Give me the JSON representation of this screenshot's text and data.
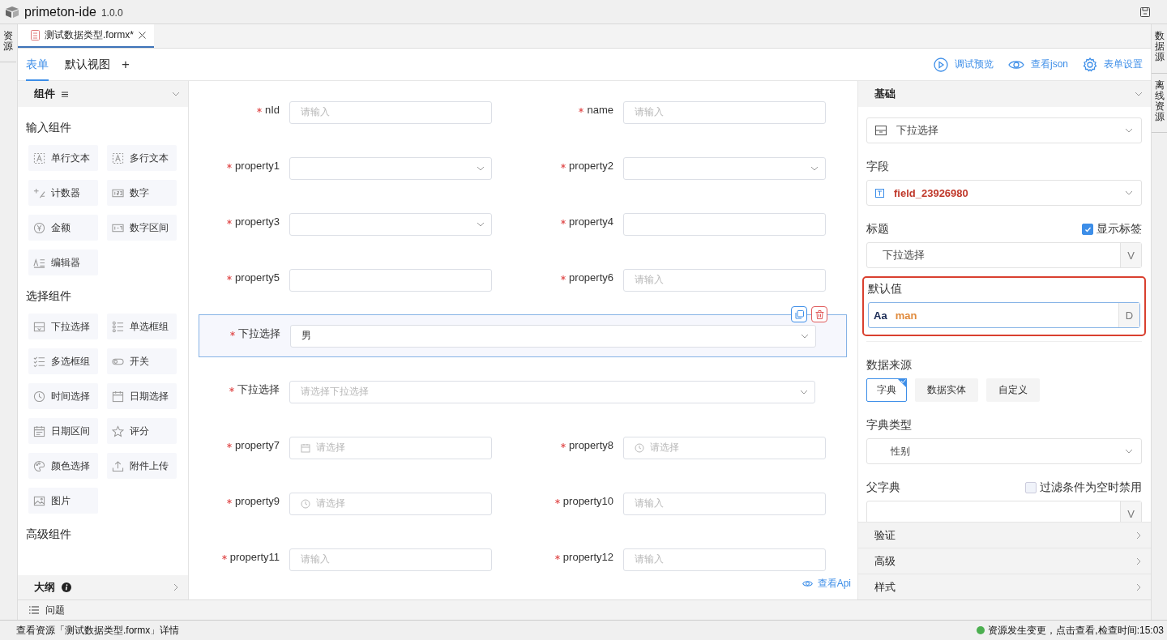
{
  "window": {
    "title": "primeton-ide",
    "version": "1.0.0"
  },
  "left_strip": [
    {
      "label": "资源"
    }
  ],
  "right_strip": [
    {
      "label": "数据源"
    },
    {
      "label": "离线资源"
    }
  ],
  "file_tabs": [
    {
      "label": "测试数据类型.formx*",
      "selected": true
    }
  ],
  "view_tabs": [
    {
      "label": "表单",
      "selected": true
    },
    {
      "label": "默认视图",
      "selected": false
    }
  ],
  "add_view": "+",
  "toolbar": [
    {
      "label": "调试预览"
    },
    {
      "label": "查看json"
    },
    {
      "label": "表单设置"
    }
  ],
  "palette": {
    "title": "组件",
    "expanded": true,
    "groups": [
      {
        "title": "输入组件",
        "items": [
          {
            "label": "单行文本"
          },
          {
            "label": "多行文本"
          },
          {
            "label": "计数器"
          },
          {
            "label": "数字"
          },
          {
            "label": "金额"
          },
          {
            "label": "数字区间"
          },
          {
            "label": "编辑器"
          }
        ]
      },
      {
        "title": "选择组件",
        "items": [
          {
            "label": "下拉选择"
          },
          {
            "label": "单选框组"
          },
          {
            "label": "多选框组"
          },
          {
            "label": "开关"
          },
          {
            "label": "时间选择"
          },
          {
            "label": "日期选择"
          },
          {
            "label": "日期区间"
          },
          {
            "label": "评分"
          },
          {
            "label": "颜色选择"
          },
          {
            "label": "附件上传"
          },
          {
            "label": "图片"
          }
        ]
      },
      {
        "title": "高级组件"
      }
    ]
  },
  "outline": {
    "title": "大纲"
  },
  "problems": {
    "title": "问题"
  },
  "form": {
    "rows": [
      {
        "selected": false,
        "fields": [
          {
            "label": "nId",
            "required": true,
            "kind": "input",
            "placeholder": "请输入"
          },
          {
            "label": "name",
            "required": true,
            "kind": "input",
            "placeholder": "请输入"
          }
        ]
      },
      {
        "selected": false,
        "fields": [
          {
            "label": "property1",
            "required": true,
            "kind": "select"
          },
          {
            "label": "property2",
            "required": true,
            "kind": "select"
          }
        ]
      },
      {
        "selected": false,
        "fields": [
          {
            "label": "property3",
            "required": true,
            "kind": "select"
          },
          {
            "label": "property4",
            "required": true,
            "kind": "input"
          }
        ]
      },
      {
        "selected": false,
        "fields": [
          {
            "label": "property5",
            "required": true,
            "kind": "input"
          },
          {
            "label": "property6",
            "required": true,
            "kind": "input",
            "placeholder": "请输入"
          }
        ]
      },
      {
        "selected": true,
        "fields": [
          {
            "label": "下拉选择",
            "required": true,
            "kind": "select",
            "value": "男"
          }
        ]
      },
      {
        "selected": false,
        "fields": [
          {
            "label": "下拉选择",
            "required": true,
            "kind": "select",
            "placeholder": "请选择下拉选择"
          }
        ]
      },
      {
        "selected": false,
        "fields": [
          {
            "label": "property7",
            "required": true,
            "kind": "date",
            "placeholder": "请选择"
          },
          {
            "label": "property8",
            "required": true,
            "kind": "time",
            "placeholder": "请选择"
          }
        ]
      },
      {
        "selected": false,
        "fields": [
          {
            "label": "property9",
            "required": true,
            "kind": "time",
            "placeholder": "请选择"
          },
          {
            "label": "property10",
            "required": true,
            "kind": "input",
            "placeholder": "请输入"
          }
        ]
      },
      {
        "selected": false,
        "fields": [
          {
            "label": "property11",
            "required": true,
            "kind": "input",
            "placeholder": "请输入"
          },
          {
            "label": "property12",
            "required": true,
            "kind": "input",
            "placeholder": "请输入"
          }
        ]
      }
    ],
    "api_link": "查看Api"
  },
  "properties": {
    "section": {
      "title": "基础",
      "expanded": true
    },
    "component": {
      "value": "下拉选择"
    },
    "field": {
      "label": "字段",
      "value": "field_23926980"
    },
    "title": {
      "label": "标题",
      "checkbox": {
        "label": "显示标签",
        "checked": true
      },
      "value": "下拉选择",
      "suffix": "V"
    },
    "default_value": {
      "label": "默认值",
      "highlighted": true,
      "prefix": "Aa",
      "value": "man",
      "suffix": "D"
    },
    "data_source": {
      "label": "数据来源",
      "options": [
        {
          "label": "字典",
          "selected": true
        },
        {
          "label": "数据实体",
          "selected": false
        },
        {
          "label": "自定义",
          "selected": false
        }
      ]
    },
    "dict_type": {
      "label": "字典类型",
      "value": "性别"
    },
    "parent_dict": {
      "label": "父字典",
      "checkbox": {
        "label": "过滤条件为空时禁用",
        "checked": false
      },
      "suffix": "V"
    },
    "sections": [
      {
        "title": "验证",
        "expanded": false
      },
      {
        "title": "高级",
        "expanded": false
      },
      {
        "title": "样式",
        "expanded": false
      }
    ]
  },
  "status_bar": {
    "left": "查看资源「测试数据类型.formx」详情",
    "right": "资源发生变更，点击查看,检查时间:15:03"
  }
}
